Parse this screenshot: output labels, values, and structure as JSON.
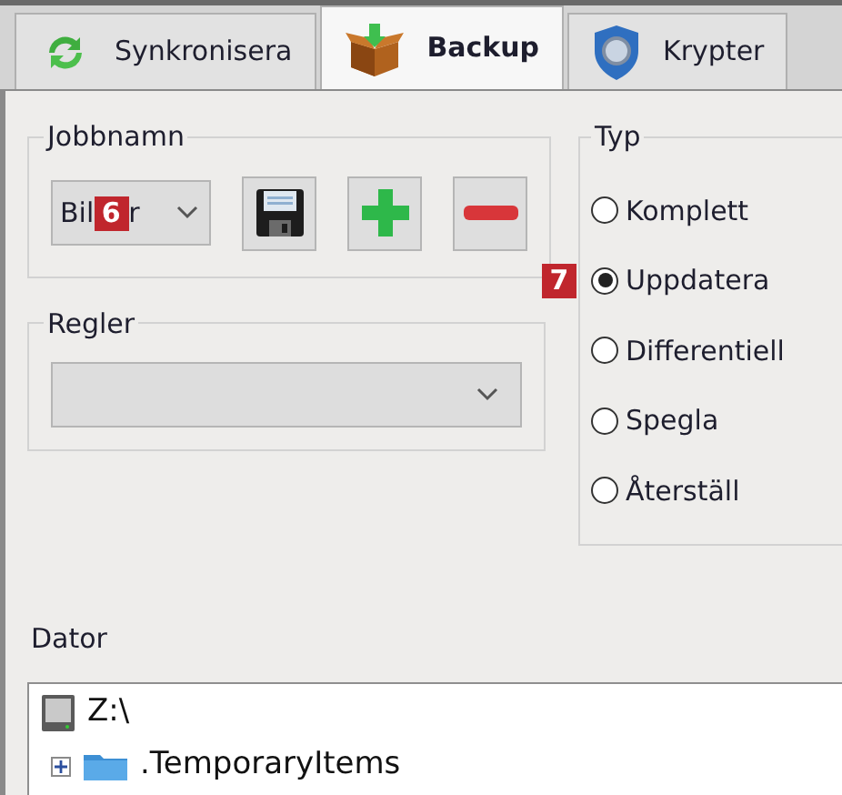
{
  "tabs": [
    {
      "label": "Synkronisera",
      "kind": "sync",
      "selected": false
    },
    {
      "label": "Backup",
      "kind": "box",
      "selected": true
    },
    {
      "label": "Krypter",
      "kind": "shield",
      "selected": false
    }
  ],
  "job_group": {
    "title": "Jobbnamn",
    "dropdown": {
      "value_start": "Bil",
      "value_end": "r"
    },
    "badge": "6",
    "buttons": [
      {
        "kind": "save"
      },
      {
        "kind": "add"
      },
      {
        "kind": "remove"
      }
    ]
  },
  "rules_group": {
    "title": "Regler"
  },
  "type_group": {
    "title": "Typ",
    "badge": "7",
    "options": [
      {
        "label": "Komplett",
        "selected": false
      },
      {
        "label": "Uppdatera",
        "selected": true
      },
      {
        "label": "Differentiell",
        "selected": false
      },
      {
        "label": "Spegla",
        "selected": false
      },
      {
        "label": "Återställ",
        "selected": false
      }
    ]
  },
  "computer": {
    "title": "Dator",
    "tree": [
      {
        "label": "Z:\\",
        "kind": "drive",
        "children": [
          {
            "label": ".TemporaryItems",
            "kind": "folder",
            "expanded": false
          }
        ]
      }
    ]
  }
}
